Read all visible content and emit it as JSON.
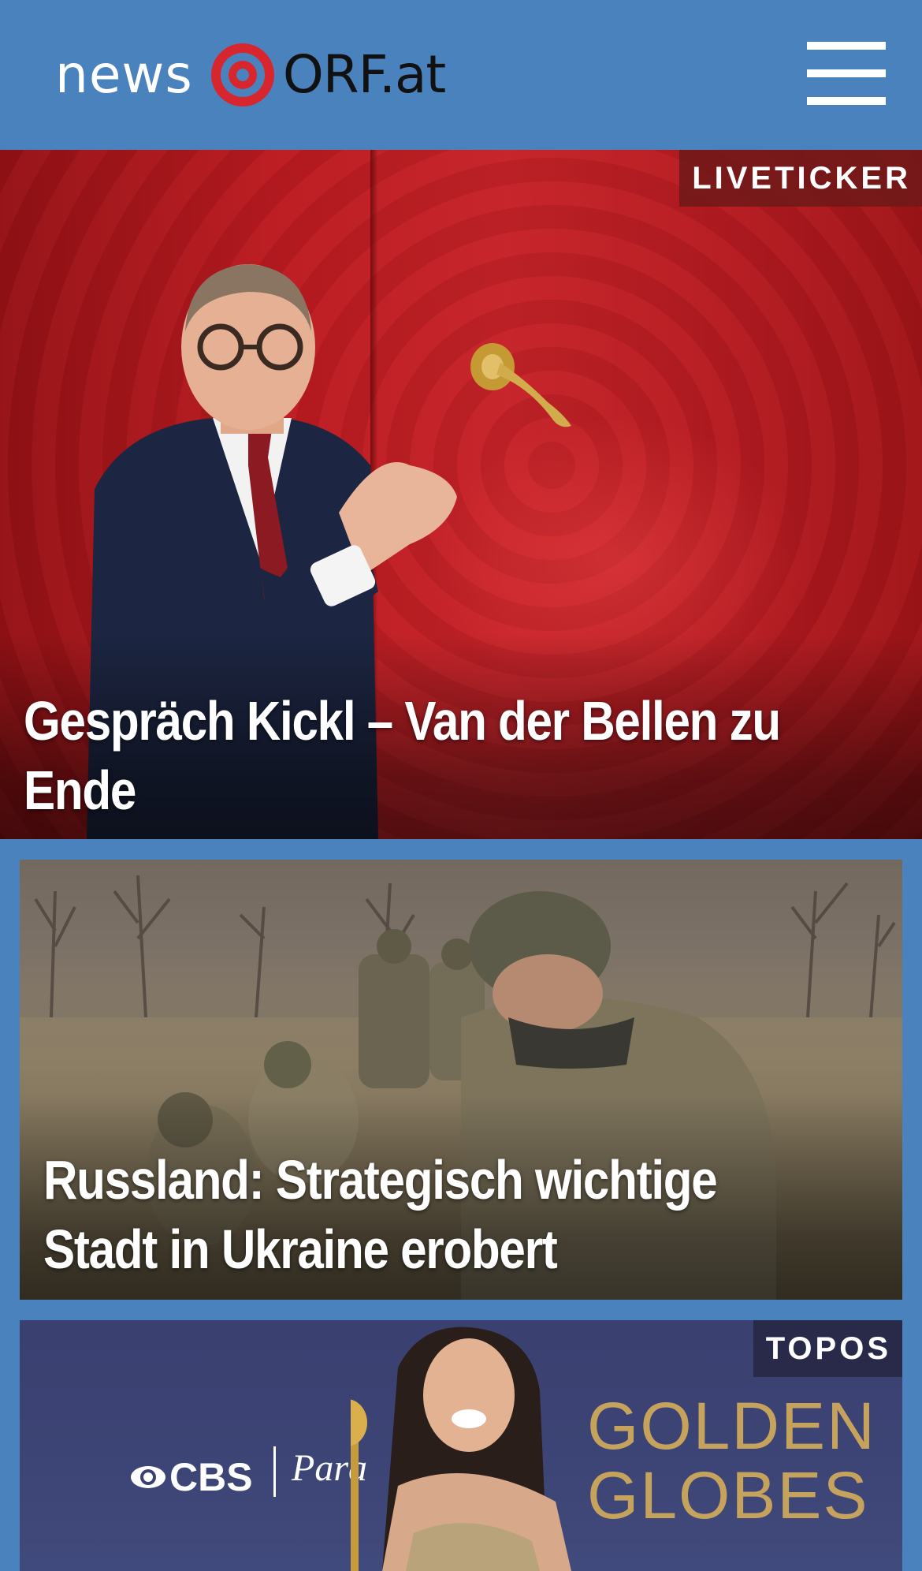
{
  "header": {
    "logo_news": "news",
    "logo_orf": "ORF.at",
    "bg_color": "#4a82be",
    "brand_red": "#d7262e",
    "menu_icon": "hamburger-menu-icon"
  },
  "teasers": [
    {
      "badge": "LIVETICKER",
      "headline": "Gespräch Kickl – Van der Bellen zu Ende"
    },
    {
      "headline": "Russland: Strategisch wichtige Stadt in Ukraine erobert"
    },
    {
      "badge": "TOPOS",
      "image_text": {
        "cbs": "CBS",
        "paramount": "Para",
        "golden_line1": "GOLDEN",
        "golden_line2": "GLOBES"
      }
    }
  ]
}
